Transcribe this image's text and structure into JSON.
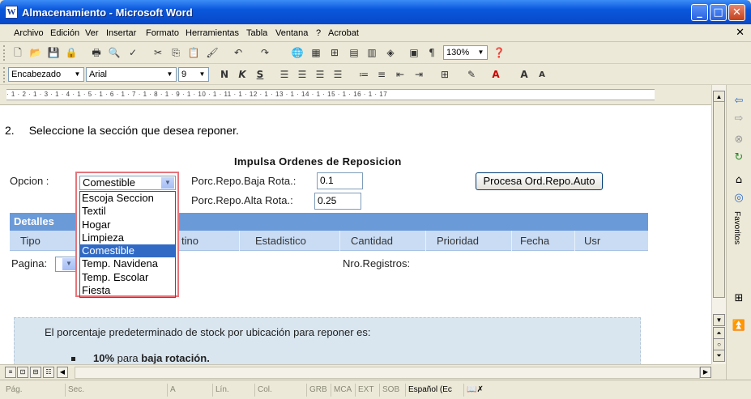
{
  "window": {
    "title": "Almacenamiento - Microsoft Word",
    "app_icon": "W"
  },
  "menu": [
    "Archivo",
    "Edición",
    "Ver",
    "Insertar",
    "Formato",
    "Herramientas",
    "Tabla",
    "Ventana",
    "?",
    "Acrobat"
  ],
  "toolbar": {
    "zoom": "130%"
  },
  "format_bar": {
    "style": "Encabezado",
    "font": "Arial",
    "size": "9"
  },
  "ruler_text": "· 1 · 2 · 1 · 3 · 1 · 4 · 1 · 5 · 1 · 6 · 1 · 7 · 1 · 8 · 1 · 9 · 1 · 10 · 1 · 11 · 1 · 12 · 1 · 13 · 1 · 14 · 1 · 15 · 1 · 16 · 1 · 17",
  "doc": {
    "step_number": "2.",
    "step_text": "Seleccione la sección que desea reponer.",
    "panel_title": "Impulsa Ordenes de Reposicion",
    "opcion_label": "Opcion :",
    "opcion_value": "Comestible",
    "baja_label": "Porc.Repo.Baja Rota.:",
    "baja_value": "0.1",
    "alta_label": "Porc.Repo.Alta Rota.:",
    "alta_value": "0.25",
    "process_button": "Procesa Ord.Repo.Auto",
    "details_header": "Detalles",
    "columns": [
      "Tipo",
      "tino",
      "Estadistico",
      "Cantidad",
      "Prioridad",
      "Fecha",
      "Usr"
    ],
    "pagina_label": "Pagina:",
    "nro_registros_label": "Nro.Registros:",
    "dropdown_options": [
      "Escoja Seccion",
      "Textil",
      "Hogar",
      "Limpieza",
      "Comestible",
      "Temp. Navidena",
      "Temp. Escolar",
      "Fiesta"
    ],
    "dropdown_selected_index": 4,
    "info_text": "El porcentaje predeterminado de stock por ubicación para reponer es:",
    "bullet_pct": "10%",
    "bullet_mid": " para ",
    "bullet_bold": "baja rotación."
  },
  "taskpane": {
    "label": "Favoritos"
  },
  "status": {
    "pag": "Pág.",
    "sec": "Sec.",
    "a": "A",
    "lin": "Lín.",
    "col": "Col.",
    "grb": "GRB",
    "mca": "MCA",
    "ext": "EXT",
    "sob": "SOB",
    "lang": "Español (Ec"
  }
}
